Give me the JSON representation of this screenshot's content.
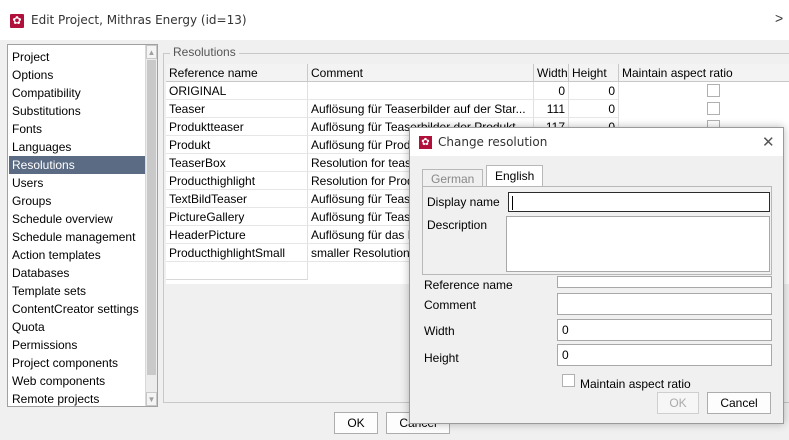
{
  "window": {
    "title": "Edit Project, Mithras Energy (id=13)",
    "icon": "settings-gear-icon",
    "accent_color": "#b0103a"
  },
  "nav": {
    "items": [
      {
        "label": "Project"
      },
      {
        "label": "Options"
      },
      {
        "label": "Compatibility"
      },
      {
        "label": "Substitutions"
      },
      {
        "label": "Fonts"
      },
      {
        "label": "Languages"
      },
      {
        "label": "Resolutions",
        "selected": true
      },
      {
        "label": "Users"
      },
      {
        "label": "Groups"
      },
      {
        "label": "Schedule overview"
      },
      {
        "label": "Schedule management"
      },
      {
        "label": "Action templates"
      },
      {
        "label": "Databases"
      },
      {
        "label": "Template sets"
      },
      {
        "label": "ContentCreator settings"
      },
      {
        "label": "Quota"
      },
      {
        "label": "Permissions"
      },
      {
        "label": "Project components"
      },
      {
        "label": "Web components"
      },
      {
        "label": "Remote projects"
      }
    ],
    "selected_color": "#5b6b84"
  },
  "resolutions": {
    "group_label": "Resolutions",
    "columns": [
      "Reference name",
      "Comment",
      "Width",
      "Height",
      "Maintain aspect ratio"
    ],
    "rows": [
      {
        "name": "ORIGINAL",
        "comment": "",
        "width": "0",
        "height": "0"
      },
      {
        "name": "Teaser",
        "comment": "Auflösung für Teaserbilder auf der Star...",
        "width": "111",
        "height": "0"
      },
      {
        "name": "Produktteaser",
        "comment": "Auflösung für Teaserbilder der Produkt...",
        "width": "117",
        "height": "0"
      },
      {
        "name": "Produkt",
        "comment": "Auflösung für Produktbilder",
        "width": "",
        "height": ""
      },
      {
        "name": "TeaserBox",
        "comment": "Resolution for teaser box",
        "width": "",
        "height": ""
      },
      {
        "name": "Producthighlight",
        "comment": "Resolution for Product highlight",
        "width": "",
        "height": ""
      },
      {
        "name": "TextBildTeaser",
        "comment": "Auflösung für Teaser mit Text und Bild",
        "width": "",
        "height": ""
      },
      {
        "name": "PictureGallery",
        "comment": "Auflösung für Teaser der Bildergalerie",
        "width": "",
        "height": ""
      },
      {
        "name": "HeaderPicture",
        "comment": "Auflösung für das Headerbild",
        "width": "",
        "height": ""
      },
      {
        "name": "ProducthighlightSmall",
        "comment": "smaller Resolution for Product highlight",
        "width": "",
        "height": ""
      }
    ]
  },
  "footer": {
    "ok_label": "OK",
    "cancel_label": "Cancel"
  },
  "dialog": {
    "title": "Change resolution",
    "icon": "settings-gear-icon",
    "tabs": [
      {
        "label": "German",
        "active": false
      },
      {
        "label": "English",
        "active": true
      }
    ],
    "display_name_label": "Display name",
    "display_name_value": "",
    "description_label": "Description",
    "description_value": "",
    "reference_name_label": "Reference name",
    "reference_name_value": "",
    "comment_label": "Comment",
    "comment_value": "",
    "width_label": "Width",
    "width_value": "0",
    "height_label": "Height",
    "height_value": "0",
    "maintain_label": "Maintain aspect ratio",
    "maintain_checked": false,
    "ok_label": "OK",
    "ok_disabled": true,
    "cancel_label": "Cancel"
  }
}
